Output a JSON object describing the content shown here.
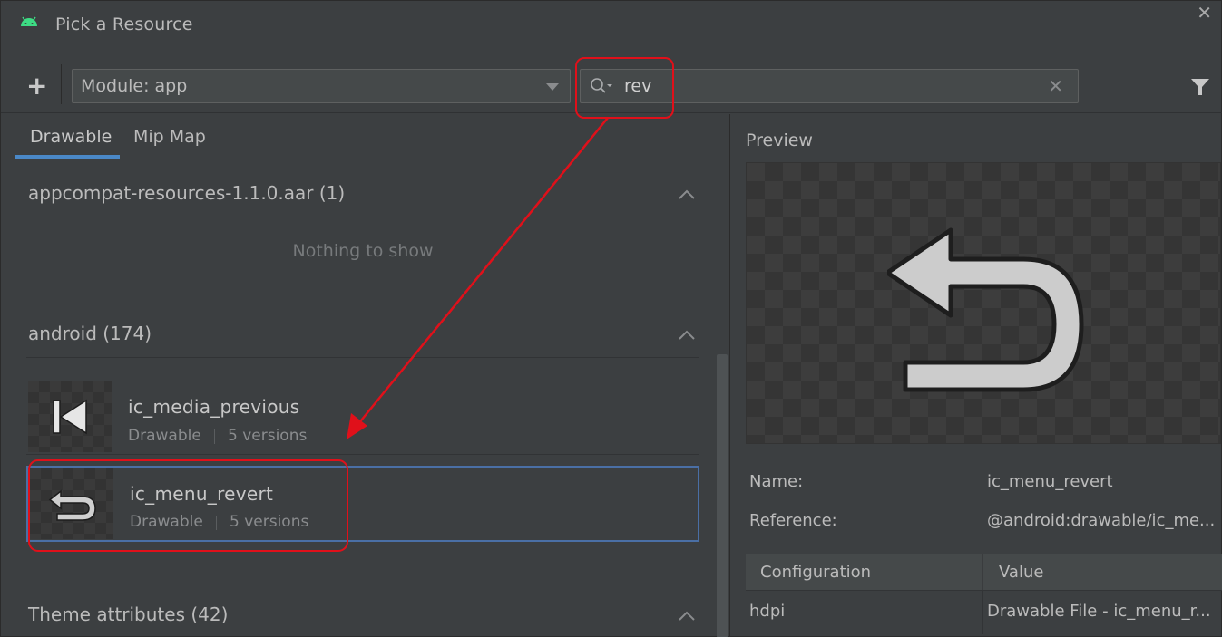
{
  "window": {
    "title": "Pick a Resource",
    "close_glyph": "✕"
  },
  "toolbar": {
    "add_glyph": "+",
    "module_select": {
      "value": "Module: app"
    },
    "search": {
      "value": "rev",
      "clear_glyph": "✕"
    }
  },
  "tabs": [
    {
      "label": "Drawable",
      "active": true
    },
    {
      "label": "Mip Map",
      "active": false
    }
  ],
  "groups": [
    {
      "title": "appcompat-resources-1.1.0.aar (1)",
      "empty_text": "Nothing to show"
    },
    {
      "title": "android (174)"
    },
    {
      "title": "Theme attributes (42)"
    }
  ],
  "items": [
    {
      "name": "ic_media_previous",
      "type": "Drawable",
      "versions": "5 versions",
      "icon": "media-previous-icon",
      "selected": false
    },
    {
      "name": "ic_menu_revert",
      "type": "Drawable",
      "versions": "5 versions",
      "icon": "menu-revert-icon",
      "selected": true
    }
  ],
  "preview": {
    "label": "Preview",
    "name_label": "Name:",
    "name_value": "ic_menu_revert",
    "reference_label": "Reference:",
    "reference_value": "@android:drawable/ic_me...",
    "config_table": {
      "headers": [
        "Configuration",
        "Value"
      ],
      "rows": [
        [
          "hdpi",
          "Drawable File - ic_menu_r..."
        ]
      ]
    }
  },
  "colors": {
    "background": "#3c3f41",
    "accent": "#4a88c7",
    "selection_border": "#4a6fa5",
    "annotation_red": "#e0101a"
  }
}
